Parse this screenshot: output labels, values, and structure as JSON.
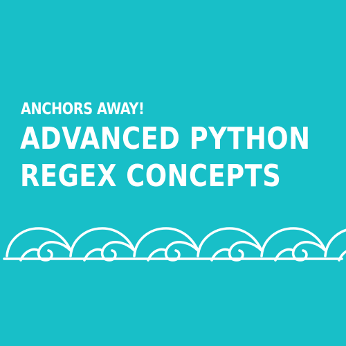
{
  "colors": {
    "background": "#18bfc8",
    "text": "#ffffff",
    "wave_stroke": "#ffffff"
  },
  "kicker": "ANCHORS AWAY!",
  "title": {
    "line1": "ADVANCED PYTHON",
    "line2": "REGEX CONCEPTS"
  },
  "decoration": {
    "icon": "wave-line-icon",
    "wave_count": 6
  }
}
